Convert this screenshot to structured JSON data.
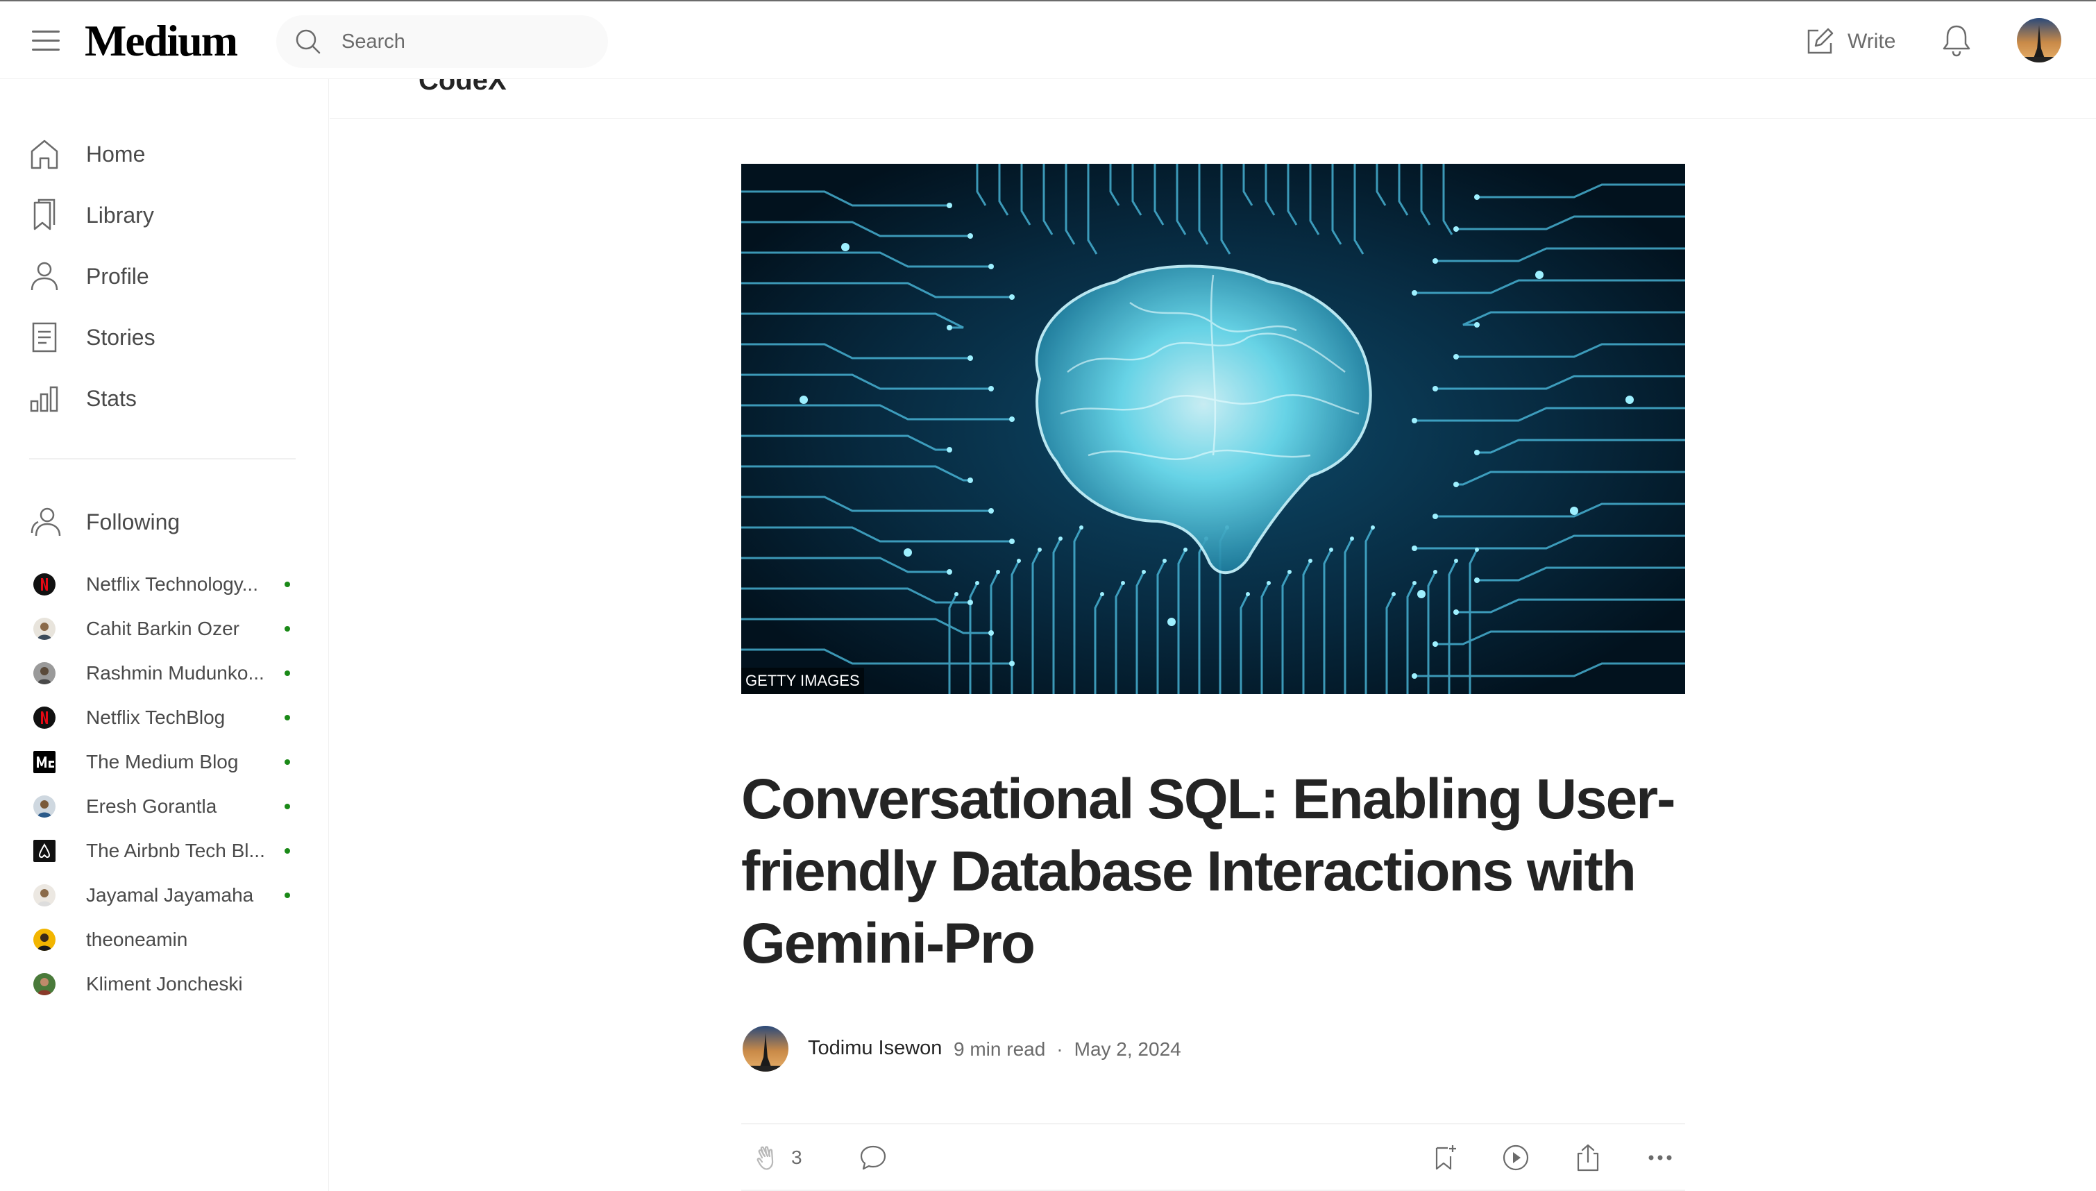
{
  "app": {
    "logo": "Medium"
  },
  "search": {
    "placeholder": "Search"
  },
  "header": {
    "write_label": "Write"
  },
  "sidebar": {
    "nav": [
      {
        "label": "Home",
        "icon": "home-icon"
      },
      {
        "label": "Library",
        "icon": "bookmark-icon"
      },
      {
        "label": "Profile",
        "icon": "user-icon"
      },
      {
        "label": "Stories",
        "icon": "document-icon"
      },
      {
        "label": "Stats",
        "icon": "bar-chart-icon"
      }
    ],
    "following_label": "Following",
    "following": [
      {
        "name": "Netflix Technology...",
        "new": true
      },
      {
        "name": "Cahit Barkin Ozer",
        "new": true
      },
      {
        "name": "Rashmin Mudunko...",
        "new": true
      },
      {
        "name": "Netflix TechBlog",
        "new": true
      },
      {
        "name": "The Medium Blog",
        "new": true
      },
      {
        "name": "Eresh Gorantla",
        "new": true
      },
      {
        "name": "The Airbnb Tech Bl...",
        "new": true
      },
      {
        "name": "Jayamal Jayamaha",
        "new": true
      },
      {
        "name": "theoneamin",
        "new": false
      },
      {
        "name": "Kliment Joncheski",
        "new": false
      }
    ]
  },
  "publication": {
    "name": "CodeX"
  },
  "article": {
    "image_credit": "GETTY IMAGES",
    "title": "Conversational SQL: Enabling User-friendly Database Interactions with Gemini-Pro",
    "author": "Todimu Isewon",
    "read_time": "9 min read",
    "separator": "·",
    "date": "May 2, 2024",
    "claps": "3"
  },
  "colors": {
    "accent_green": "#1a8917",
    "text": "#242424",
    "muted": "#6b6b6b"
  }
}
